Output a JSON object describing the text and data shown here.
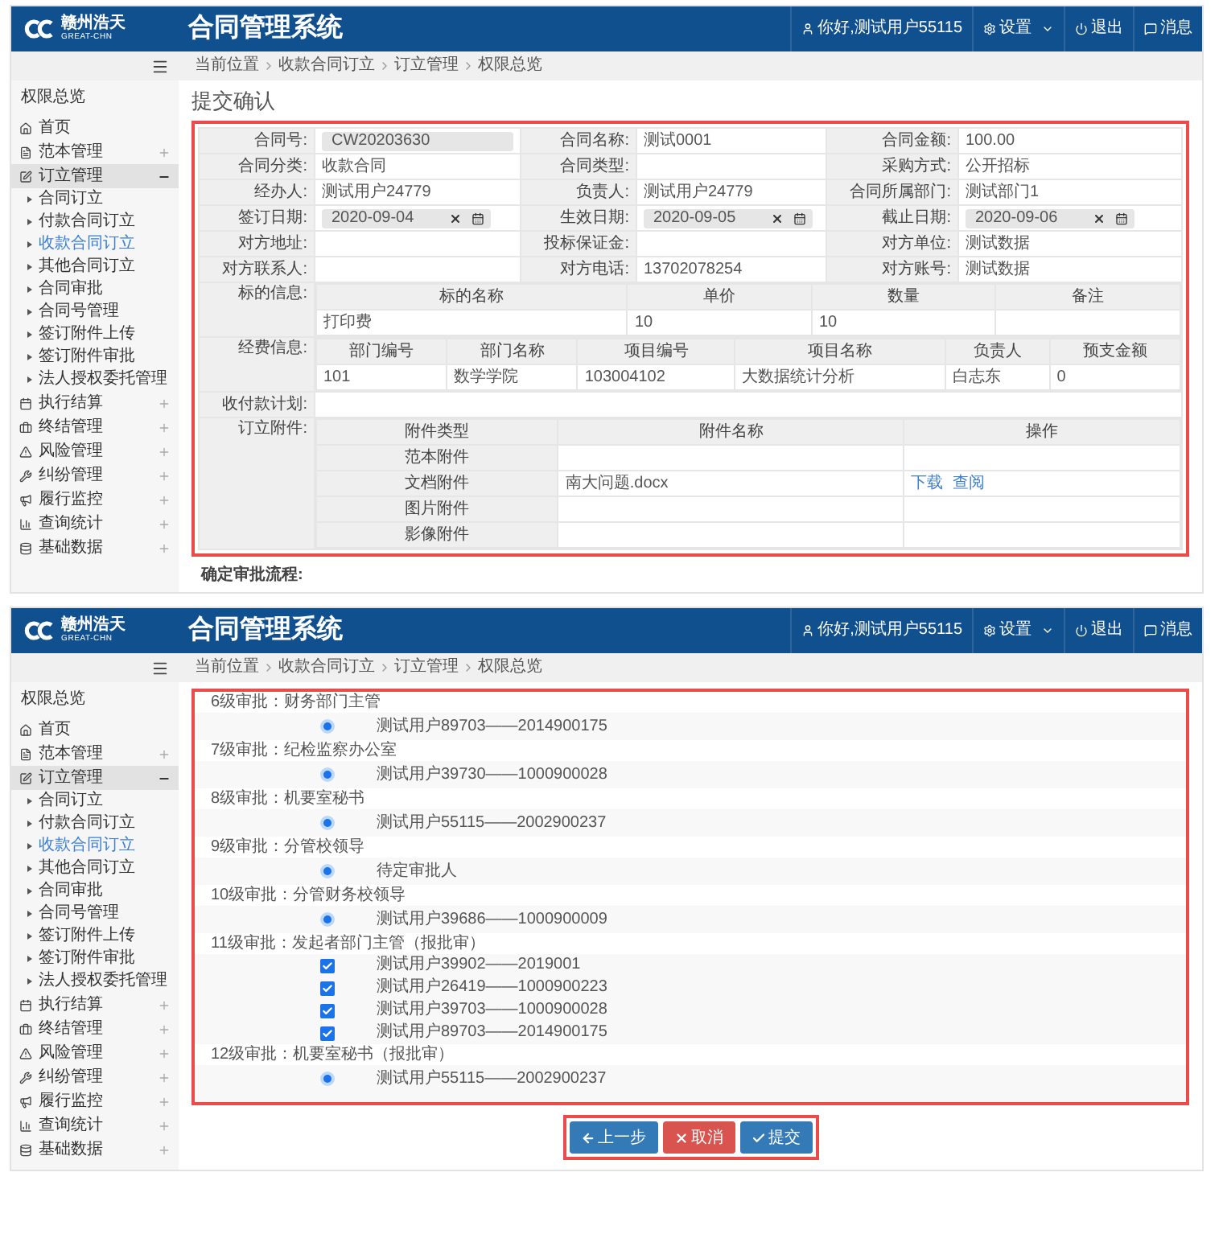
{
  "screens": [
    {
      "kind": "form",
      "logo": {
        "name": "赣州浩天",
        "tagline": "GREAT-CHN"
      },
      "app_title": "合同管理系统",
      "user_menu": [
        {
          "kind": "user",
          "label": "你好,测试用户55115"
        },
        {
          "kind": "settings",
          "label": "设置"
        },
        {
          "kind": "logout",
          "label": "退出"
        },
        {
          "kind": "messages",
          "label": "消息"
        }
      ],
      "breadcrumb": [
        "当前位置",
        "收款合同订立",
        "订立管理",
        "权限总览"
      ],
      "sidebar": {
        "title": "权限总览",
        "items": [
          {
            "kind": "link",
            "label": "首页",
            "expanded": false
          },
          {
            "kind": "group",
            "label": "范本管理",
            "expanded": false
          },
          {
            "kind": "group",
            "label": "订立管理",
            "expanded": true,
            "children": [
              {
                "label": "合同订立",
                "selected": false
              },
              {
                "label": "付款合同订立",
                "selected": false
              },
              {
                "label": "收款合同订立",
                "selected": true
              },
              {
                "label": "其他合同订立",
                "selected": false
              },
              {
                "label": "合同审批",
                "selected": false
              },
              {
                "label": "合同号管理",
                "selected": false
              },
              {
                "label": "签订附件上传",
                "selected": false
              },
              {
                "label": "签订附件审批",
                "selected": false
              },
              {
                "label": "法人授权委托管理",
                "selected": false
              }
            ]
          },
          {
            "kind": "group",
            "label": "执行结算",
            "expanded": false
          },
          {
            "kind": "group",
            "label": "终结管理",
            "expanded": false
          },
          {
            "kind": "group",
            "label": "风险管理",
            "expanded": false
          },
          {
            "kind": "group",
            "label": "纠纷管理",
            "expanded": false
          },
          {
            "kind": "group",
            "label": "履行监控",
            "expanded": false
          },
          {
            "kind": "group",
            "label": "查询统计",
            "expanded": false
          },
          {
            "kind": "group",
            "label": "基础数据",
            "expanded": false
          }
        ]
      },
      "page_title": "提交确认",
      "field_rows": [
        [
          {
            "label": "合同号:",
            "value": "CW20203630",
            "kind": "input"
          },
          {
            "label": "合同名称:",
            "value": "测试0001",
            "kind": "text"
          },
          {
            "label": "合同金额:",
            "value": "100.00",
            "kind": "text"
          }
        ],
        [
          {
            "label": "合同分类:",
            "value": "收款合同",
            "kind": "text"
          },
          {
            "label": "合同类型:",
            "kind": "text"
          },
          {
            "label": "采购方式:",
            "value": "公开招标",
            "kind": "text"
          }
        ],
        [
          {
            "label": "经办人:",
            "value": "测试用户24779",
            "kind": "text"
          },
          {
            "label": "负责人:",
            "value": "测试用户24779",
            "kind": "text"
          },
          {
            "label": "合同所属部门:",
            "value": "测试部门1",
            "kind": "text"
          }
        ],
        [
          {
            "label": "签订日期:",
            "value": "2020-09-04",
            "kind": "date"
          },
          {
            "label": "生效日期:",
            "value": "2020-09-05",
            "kind": "date"
          },
          {
            "label": "截止日期:",
            "value": "2020-09-06",
            "kind": "date"
          }
        ],
        [
          {
            "label": "对方地址:",
            "kind": "text"
          },
          {
            "label": "投标保证金:",
            "kind": "text"
          },
          {
            "label": "对方单位:",
            "value": "测试数据",
            "kind": "text"
          }
        ],
        [
          {
            "label": "对方联系人:",
            "kind": "text"
          },
          {
            "label": "对方电话:",
            "value": "13702078254",
            "kind": "text"
          },
          {
            "label": "对方账号:",
            "value": "测试数据",
            "kind": "text"
          }
        ]
      ],
      "subject_info": {
        "label": "标的信息:",
        "columns": [
          "标的名称",
          "单价",
          "数量",
          "备注"
        ],
        "rows": [
          [
            "打印费",
            "10",
            "10"
          ]
        ]
      },
      "funding_info": {
        "label": "经费信息:",
        "columns": [
          "部门编号",
          "部门名称",
          "项目编号",
          "项目名称",
          "负责人",
          "预支金额"
        ],
        "rows": [
          [
            "101",
            "数学学院",
            "103004102",
            "大数据统计分析",
            "白志东",
            "0"
          ]
        ]
      },
      "payment_plan": {
        "label": "收付款计划:"
      },
      "attachments": {
        "label": "订立附件:",
        "columns": [
          "附件类型",
          "附件名称",
          "操作"
        ],
        "rows": [
          {
            "type": "范本附件"
          },
          {
            "type": "文档附件",
            "file": "南大问题.docx",
            "actions": [
              "下载",
              "查阅"
            ]
          },
          {
            "type": "图片附件"
          },
          {
            "type": "影像附件"
          }
        ]
      },
      "next_section": "确定审批流程:"
    },
    {
      "kind": "approval",
      "logo": {
        "name": "赣州浩天",
        "tagline": "GREAT-CHN"
      },
      "app_title": "合同管理系统",
      "user_menu": [
        {
          "kind": "user",
          "label": "你好,测试用户55115"
        },
        {
          "kind": "settings",
          "label": "设置"
        },
        {
          "kind": "logout",
          "label": "退出"
        },
        {
          "kind": "messages",
          "label": "消息"
        }
      ],
      "breadcrumb": [
        "当前位置",
        "收款合同订立",
        "订立管理",
        "权限总览"
      ],
      "sidebar": {
        "title": "权限总览",
        "items": [
          {
            "kind": "link",
            "label": "首页",
            "expanded": false
          },
          {
            "kind": "group",
            "label": "范本管理",
            "expanded": false
          },
          {
            "kind": "group",
            "label": "订立管理",
            "expanded": true,
            "children": [
              {
                "label": "合同订立",
                "selected": false
              },
              {
                "label": "付款合同订立",
                "selected": false
              },
              {
                "label": "收款合同订立",
                "selected": true
              },
              {
                "label": "其他合同订立",
                "selected": false
              },
              {
                "label": "合同审批",
                "selected": false
              },
              {
                "label": "合同号管理",
                "selected": false
              },
              {
                "label": "签订附件上传",
                "selected": false
              },
              {
                "label": "签订附件审批",
                "selected": false
              },
              {
                "label": "法人授权委托管理",
                "selected": false
              }
            ]
          },
          {
            "kind": "group",
            "label": "执行结算",
            "expanded": false
          },
          {
            "kind": "group",
            "label": "终结管理",
            "expanded": false
          },
          {
            "kind": "group",
            "label": "风险管理",
            "expanded": false
          },
          {
            "kind": "group",
            "label": "纠纷管理",
            "expanded": false
          },
          {
            "kind": "group",
            "label": "履行监控",
            "expanded": false
          },
          {
            "kind": "group",
            "label": "查询统计",
            "expanded": false
          },
          {
            "kind": "group",
            "label": "基础数据",
            "expanded": false
          }
        ]
      },
      "approval_steps": [
        {
          "title": "6级审批：财务部门主管",
          "approvers": [
            {
              "kind": "radio",
              "name": "测试用户89703——2014900175",
              "checked": true
            }
          ]
        },
        {
          "title": "7级审批：纪检监察办公室",
          "approvers": [
            {
              "kind": "radio",
              "name": "测试用户39730——1000900028",
              "checked": true
            }
          ]
        },
        {
          "title": "8级审批：机要室秘书",
          "approvers": [
            {
              "kind": "radio",
              "name": "测试用户55115——2002900237",
              "checked": true
            }
          ]
        },
        {
          "title": "9级审批：分管校领导",
          "approvers": [
            {
              "kind": "radio",
              "name": "待定审批人",
              "checked": true
            }
          ]
        },
        {
          "title": "10级审批：分管财务校领导",
          "approvers": [
            {
              "kind": "radio",
              "name": "测试用户39686——1000900009",
              "checked": true
            }
          ]
        },
        {
          "title": "11级审批：发起者部门主管（报批审）",
          "approvers": [
            {
              "kind": "checkbox",
              "name": "测试用户39902——2019001",
              "checked": true
            },
            {
              "kind": "checkbox",
              "name": "测试用户26419——1000900223",
              "checked": true
            },
            {
              "kind": "checkbox",
              "name": "测试用户39703——1000900028",
              "checked": true
            },
            {
              "kind": "checkbox",
              "name": "测试用户89703——2014900175",
              "checked": true
            }
          ]
        },
        {
          "title": "12级审批：机要室秘书（报批审）",
          "approvers": [
            {
              "kind": "radio",
              "name": "测试用户55115——2002900237",
              "checked": true
            }
          ]
        }
      ],
      "buttons": [
        {
          "kind": "back",
          "label": "上一步"
        },
        {
          "kind": "cancel",
          "label": "取消"
        },
        {
          "kind": "submit",
          "label": "提交"
        }
      ]
    }
  ]
}
